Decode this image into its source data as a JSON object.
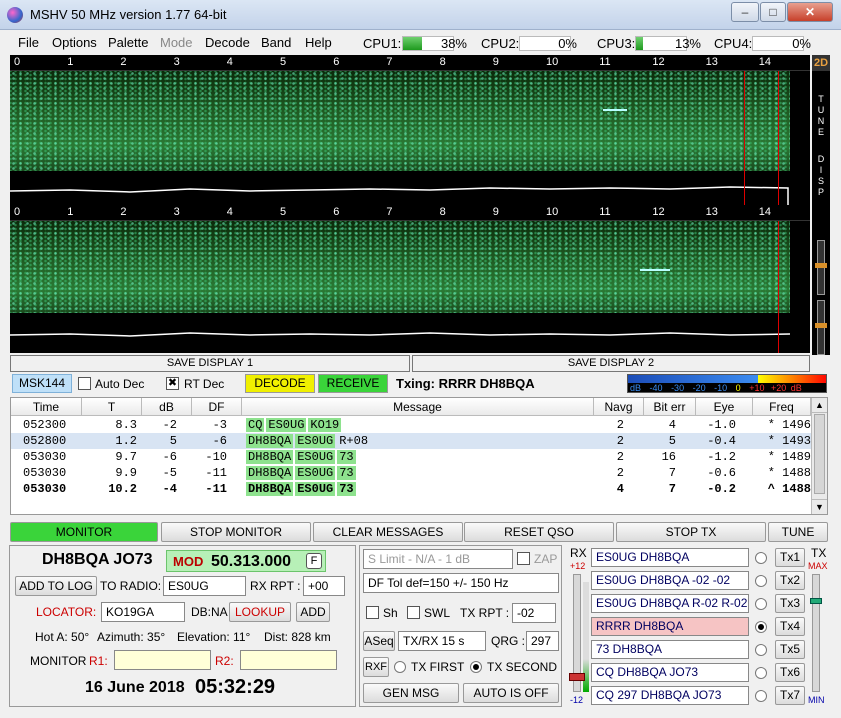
{
  "window": {
    "title": "MSHV 50 MHz version 1.77 64-bit",
    "min": "–",
    "max": "□",
    "close": "✕"
  },
  "menu": [
    "File",
    "Options",
    "Palette",
    "Mode",
    "Decode",
    "Band",
    "Help"
  ],
  "cpu": [
    {
      "label": "CPU1:",
      "pct": "38%",
      "value": 38
    },
    {
      "label": "CPU2:",
      "pct": "0%",
      "value": 0
    },
    {
      "label": "CPU3:",
      "pct": "13%",
      "value": 13
    },
    {
      "label": "CPU4:",
      "pct": "0%",
      "value": 0
    }
  ],
  "waterfall": {
    "ticks": [
      "0",
      "1",
      "2",
      "3",
      "4",
      "5",
      "6",
      "7",
      "8",
      "9",
      "10",
      "11",
      "12",
      "13",
      "14",
      "15"
    ],
    "side_2d": "2D",
    "side_tune": "TUNE",
    "side_disp": "DISP",
    "save1": "SAVE DISPLAY 1",
    "save2": "SAVE DISPLAY 2"
  },
  "controls": {
    "mode": "MSK144",
    "auto_dec": "Auto Dec",
    "rt_dec": "RT Dec",
    "rt_dec_checked": "✖",
    "decode": "DECODE",
    "receive": "RECEIVE",
    "txing": "Txing: RRRR DH8BQA",
    "meter_scale": [
      "dB",
      "-40",
      "-30",
      "-20",
      "-10",
      "0",
      "+10",
      "+20",
      "dB"
    ]
  },
  "table": {
    "headers": [
      "Time",
      "T",
      "dB",
      "DF",
      "Message",
      "Navg",
      "Bit err",
      "Eye",
      "Freq"
    ],
    "rows": [
      {
        "time": "052300",
        "t": "8.3",
        "db": "-2",
        "df": "-3",
        "msg": [
          "CQ",
          "ES0UG",
          "KO19"
        ],
        "navg": "2",
        "biterr": "4",
        "eye": "-1.0",
        "freq": "* 1496"
      },
      {
        "time": "052800",
        "t": "1.2",
        "db": "5",
        "df": "-6",
        "msg": [
          "DH8BQA",
          "ES0UG",
          "R+08"
        ],
        "navg": "2",
        "biterr": "5",
        "eye": "-0.4",
        "freq": "* 1493"
      },
      {
        "time": "053030",
        "t": "9.7",
        "db": "-6",
        "df": "-10",
        "msg": [
          "DH8BQA",
          "ES0UG",
          "73"
        ],
        "navg": "2",
        "biterr": "16",
        "eye": "-1.2",
        "freq": "* 1489"
      },
      {
        "time": "053030",
        "t": "9.9",
        "db": "-5",
        "df": "-11",
        "msg": [
          "DH8BQA",
          "ES0UG",
          "73"
        ],
        "navg": "2",
        "biterr": "7",
        "eye": "-0.6",
        "freq": "* 1488"
      },
      {
        "time": "053030",
        "t": "10.2",
        "db": "-4",
        "df": "-11",
        "msg": [
          "DH8BQA",
          "ES0UG",
          "73"
        ],
        "navg": "4",
        "biterr": "7",
        "eye": "-0.2",
        "freq": "^ 1488"
      }
    ]
  },
  "buttons": [
    "MONITOR",
    "STOP MONITOR",
    "CLEAR MESSAGES",
    "RESET QSO",
    "STOP TX",
    "TUNE"
  ],
  "station": {
    "call": "DH8BQA JO73",
    "mod_label": "MOD",
    "freq": "50.313.000",
    "f_btn": "F",
    "add_to_log": "ADD TO LOG",
    "to_radio": "TO RADIO:",
    "to_radio_val": "ES0UG",
    "rx_rpt": "RX RPT :",
    "rx_rpt_val": "+00",
    "locator_label": "LOCATOR:",
    "locator_val": "KO19GA",
    "db_na": "DB:NA",
    "lookup": "LOOKUP",
    "add": "ADD",
    "hot_a": "Hot A: 50°",
    "azimuth": "Azimuth: 35°",
    "elevation": "Elevation: 11°",
    "dist": "Dist: 828 km",
    "monitor": "MONITOR",
    "r1": "R1:",
    "r2": "R2:",
    "date": "16 June 2018",
    "time": "05:32:29"
  },
  "mid": {
    "slimit": "S Limit - N/A - 1  dB",
    "zap": "ZAP",
    "dftol": "DF Tol def=150 +/-  150  Hz",
    "sh": "Sh",
    "swl": "SWL",
    "tx_rpt": "TX RPT :",
    "tx_rpt_val": "-02",
    "aseq": "ASeq",
    "txrx": "TX/RX 15  s",
    "qrg": "QRG :",
    "qrg_val": "297",
    "rxf": "RXF",
    "tx_first": "TX FIRST",
    "tx_second": "TX SECOND",
    "gen_msg": "GEN MSG",
    "auto_off": "AUTO IS OFF"
  },
  "tx": {
    "rx_label": "RX",
    "rx_plus": "+12",
    "rx_minus": "-12",
    "tx_label": "TX",
    "max": "MAX",
    "min": "MIN",
    "messages": [
      "ES0UG DH8BQA",
      "ES0UG DH8BQA -02 -02",
      "ES0UG DH8BQA R-02 R-02",
      "RRRR DH8BQA",
      "73 DH8BQA",
      "CQ DH8BQA JO73",
      "CQ 297 DH8BQA JO73"
    ],
    "buttons": [
      "Tx1",
      "Tx2",
      "Tx3",
      "Tx4",
      "Tx5",
      "Tx6",
      "Tx7"
    ],
    "active": 3
  },
  "colors": {
    "accent_green": "#3ad43a",
    "mod_green": "#7be37b",
    "decode_yellow": "#f0f000",
    "tx_pink": "#f6c4c4",
    "label_red": "#cc0000"
  }
}
